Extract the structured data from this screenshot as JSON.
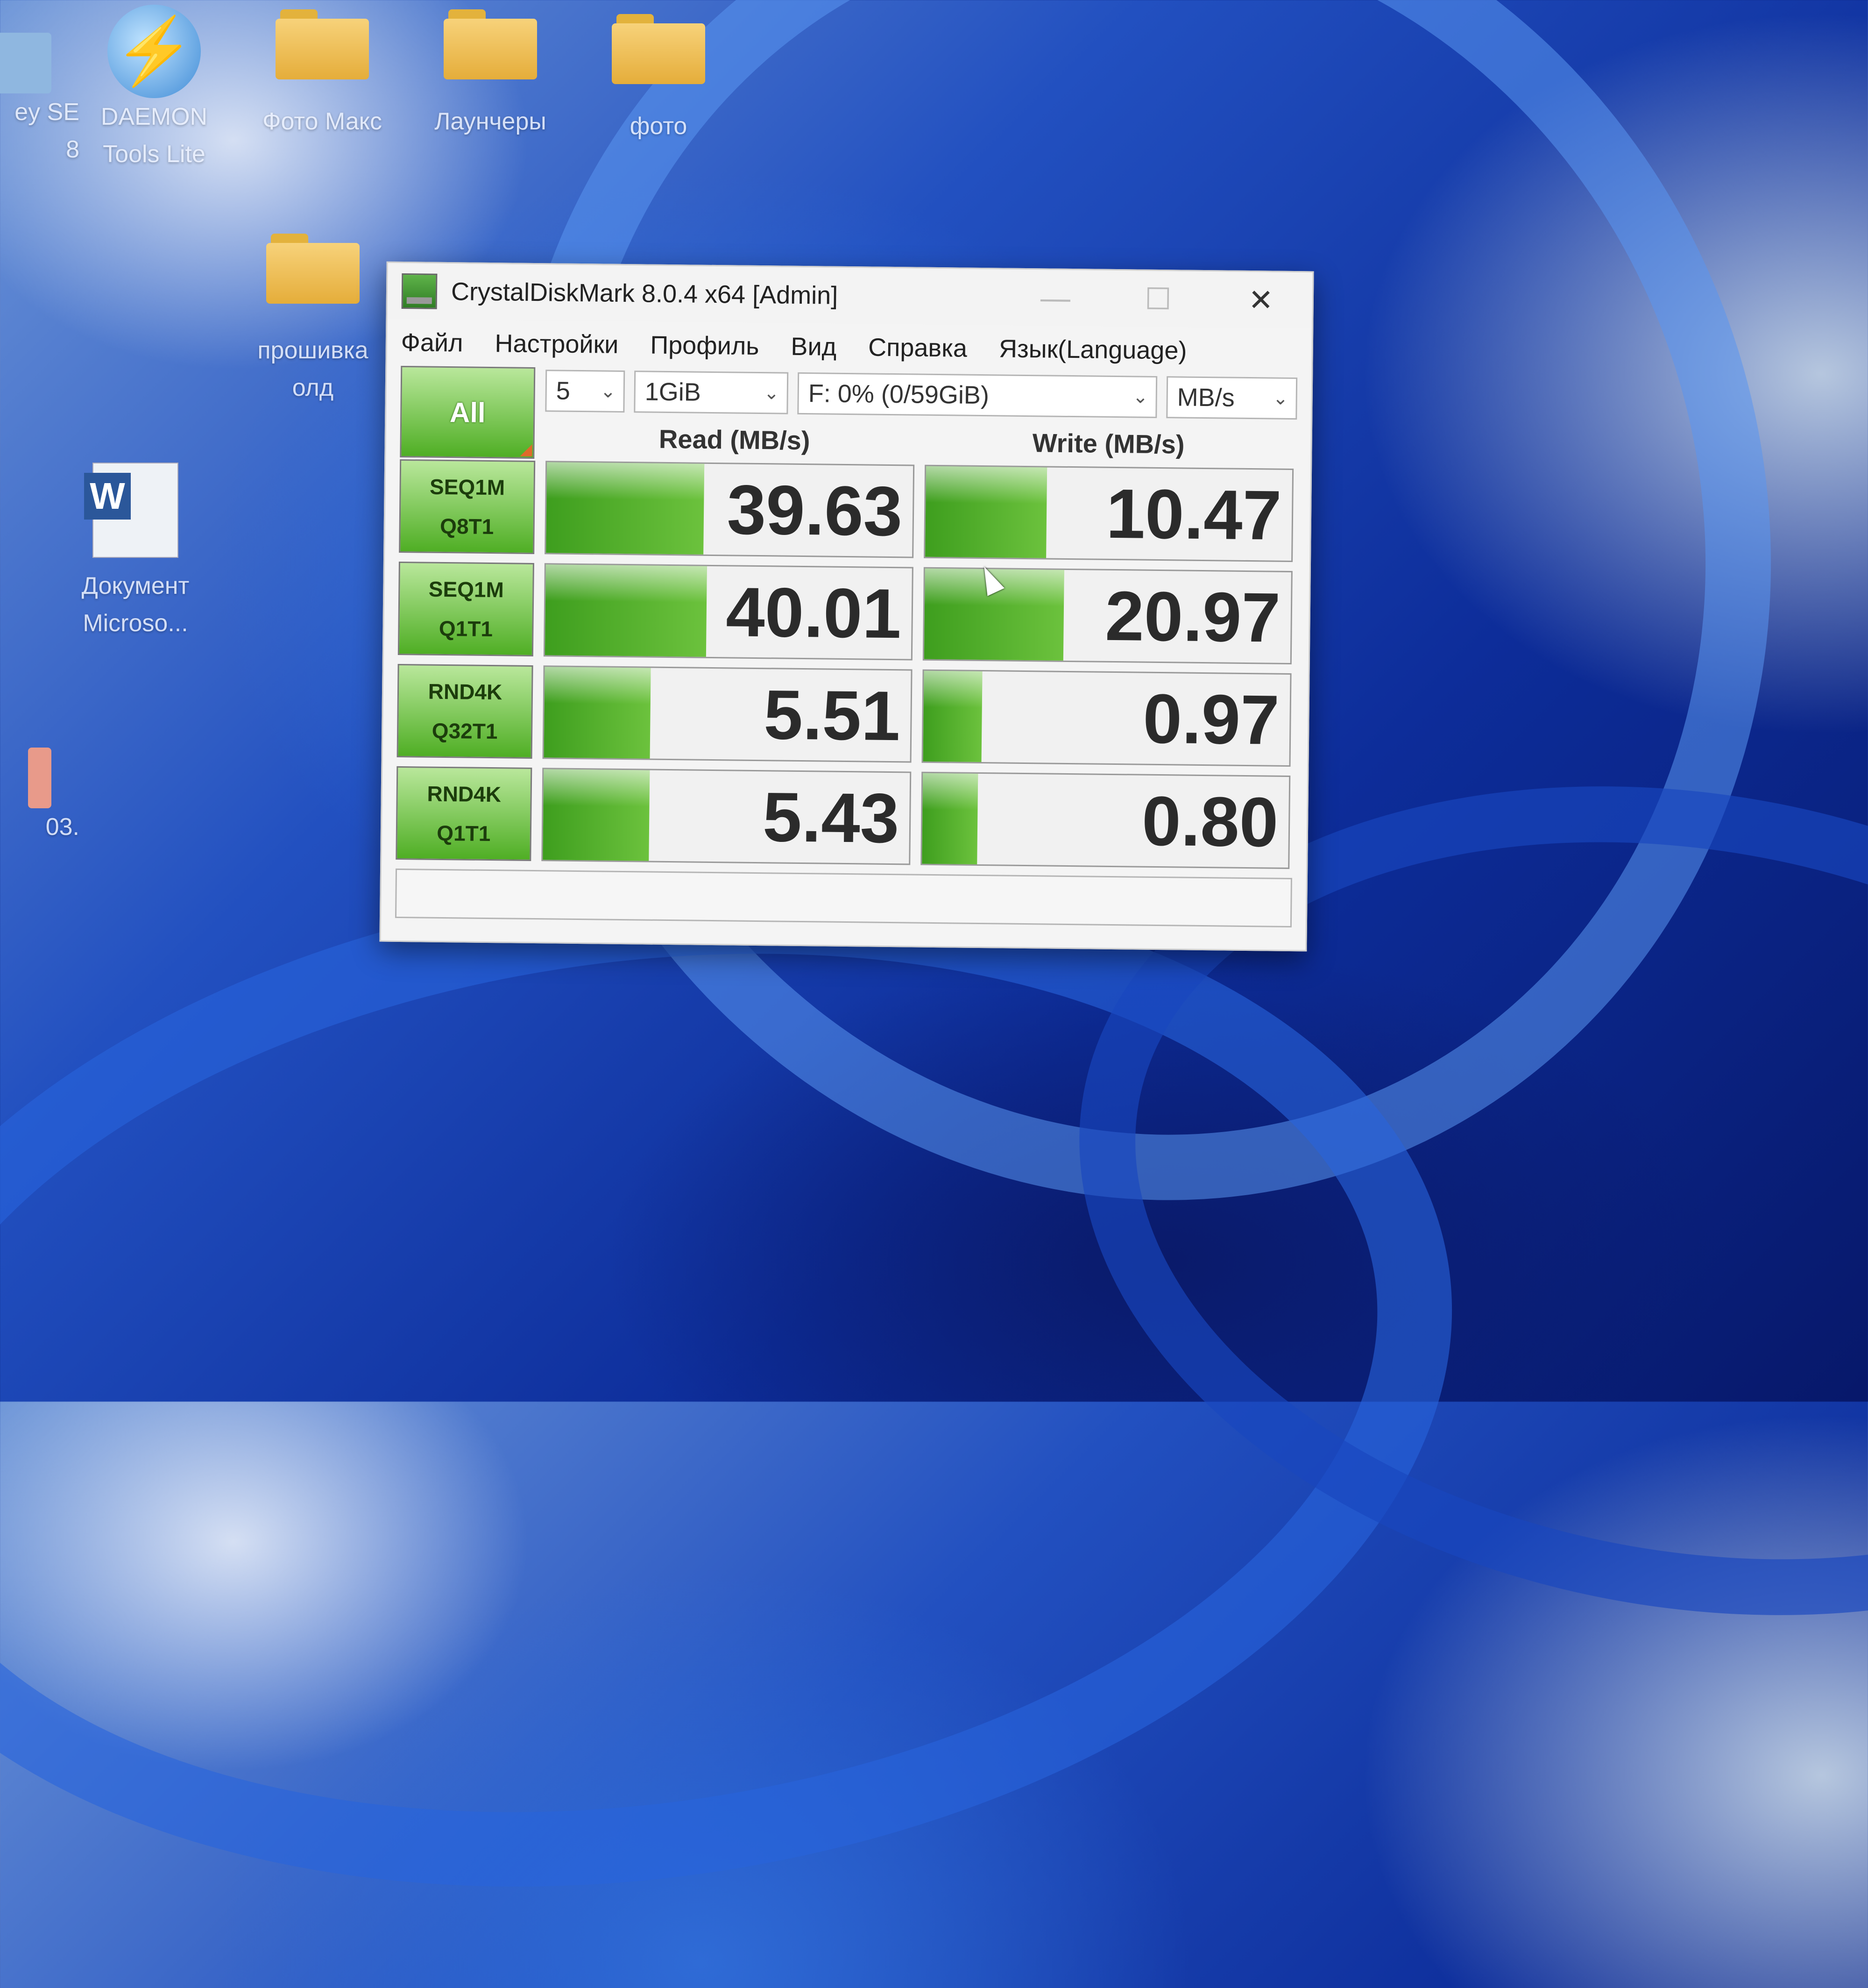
{
  "desktop": {
    "icons": [
      {
        "label": "ey SE\n8"
      },
      {
        "label": "DAEMON Tools Lite"
      },
      {
        "label": "Фото Макс"
      },
      {
        "label": "Лаунчеры"
      },
      {
        "label": "фото"
      },
      {
        "label": "прошивка олд"
      },
      {
        "label": "Документ Microso..."
      },
      {
        "label": "03."
      }
    ]
  },
  "window": {
    "title": "CrystalDiskMark 8.0.4 x64 [Admin]",
    "controls": {
      "minimize": "—",
      "maximize": "☐",
      "close": "✕"
    },
    "menu": [
      "Файл",
      "Настройки",
      "Профиль",
      "Вид",
      "Справка",
      "Язык(Language)"
    ],
    "all_button": "All",
    "count_select": "5",
    "size_select": "1GiB",
    "drive_select": "F: 0% (0/59GiB)",
    "unit_select": "MB/s",
    "read_header": "Read (MB/s)",
    "write_header": "Write (MB/s)",
    "tests": [
      {
        "line1": "SEQ1M",
        "line2": "Q8T1",
        "read": "39.63",
        "write": "10.47",
        "read_fill": 0.43,
        "write_fill": 0.33
      },
      {
        "line1": "SEQ1M",
        "line2": "Q1T1",
        "read": "40.01",
        "write": "20.97",
        "read_fill": 0.44,
        "write_fill": 0.38
      },
      {
        "line1": "RND4K",
        "line2": "Q32T1",
        "read": "5.51",
        "write": "0.97",
        "read_fill": 0.29,
        "write_fill": 0.16
      },
      {
        "line1": "RND4K",
        "line2": "Q1T1",
        "read": "5.43",
        "write": "0.80",
        "read_fill": 0.29,
        "write_fill": 0.15
      }
    ],
    "status_text": ""
  },
  "colors": {
    "bar_green": "#4fae24",
    "button_green": "#b9e79b",
    "wallpaper_blue": "#2250c0"
  }
}
